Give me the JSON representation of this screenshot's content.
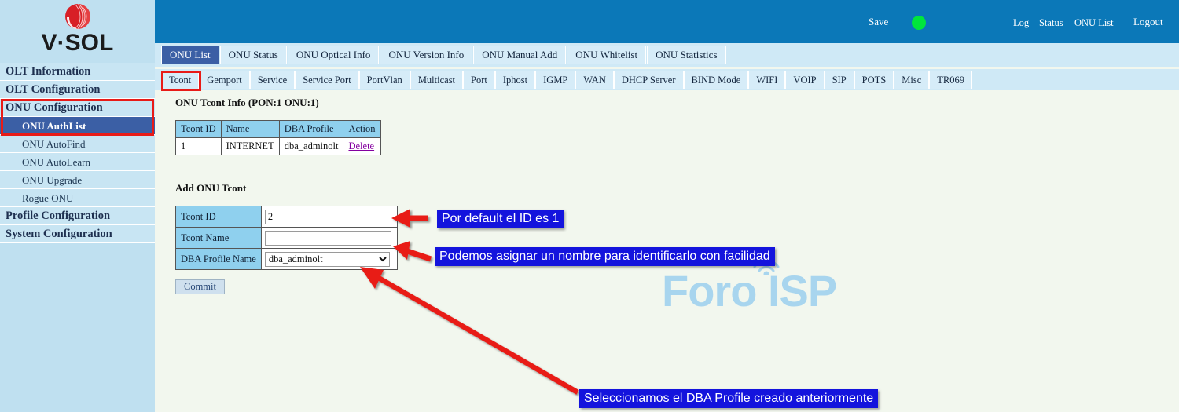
{
  "brand": {
    "logo_text": "V·SOL",
    "logo_icon": "vsol-ball-logo"
  },
  "sidebar": {
    "items": [
      {
        "label": "OLT Information",
        "level": "top",
        "selected": false
      },
      {
        "label": "OLT Configuration",
        "level": "top",
        "selected": false
      },
      {
        "label": "ONU Configuration",
        "level": "top",
        "selected": false
      },
      {
        "label": "ONU AuthList",
        "level": "sub",
        "selected": true
      },
      {
        "label": "ONU AutoFind",
        "level": "sub",
        "selected": false
      },
      {
        "label": "ONU AutoLearn",
        "level": "sub",
        "selected": false
      },
      {
        "label": "ONU Upgrade",
        "level": "sub",
        "selected": false
      },
      {
        "label": "Rogue ONU",
        "level": "sub",
        "selected": false
      },
      {
        "label": "Profile Configuration",
        "level": "top",
        "selected": false
      },
      {
        "label": "System Configuration",
        "level": "top",
        "selected": false
      }
    ]
  },
  "header": {
    "save_label": "Save",
    "status_indicator_color": "#00e63c",
    "links": [
      {
        "label": "Log"
      },
      {
        "label": "Status"
      },
      {
        "label": "ONU List"
      },
      {
        "label": "Logout"
      }
    ]
  },
  "tabs_primary": {
    "items": [
      {
        "label": "ONU List",
        "active": true
      },
      {
        "label": "ONU Status",
        "active": false
      },
      {
        "label": "ONU Optical Info",
        "active": false
      },
      {
        "label": "ONU Version Info",
        "active": false
      },
      {
        "label": "ONU Manual Add",
        "active": false
      },
      {
        "label": "ONU Whitelist",
        "active": false
      },
      {
        "label": "ONU Statistics",
        "active": false
      }
    ]
  },
  "tabs_secondary": {
    "items": [
      {
        "label": "Tcont",
        "highlighted": true
      },
      {
        "label": "Gemport",
        "highlighted": false
      },
      {
        "label": "Service",
        "highlighted": false
      },
      {
        "label": "Service Port",
        "highlighted": false
      },
      {
        "label": "PortVlan",
        "highlighted": false
      },
      {
        "label": "Multicast",
        "highlighted": false
      },
      {
        "label": "Port",
        "highlighted": false
      },
      {
        "label": "Iphost",
        "highlighted": false
      },
      {
        "label": "IGMP",
        "highlighted": false
      },
      {
        "label": "WAN",
        "highlighted": false
      },
      {
        "label": "DHCP Server",
        "highlighted": false
      },
      {
        "label": "BIND Mode",
        "highlighted": false
      },
      {
        "label": "WIFI",
        "highlighted": false
      },
      {
        "label": "VOIP",
        "highlighted": false
      },
      {
        "label": "SIP",
        "highlighted": false
      },
      {
        "label": "POTS",
        "highlighted": false
      },
      {
        "label": "Misc",
        "highlighted": false
      },
      {
        "label": "TR069",
        "highlighted": false
      }
    ]
  },
  "main": {
    "info_title": "ONU Tcont Info (PON:1 ONU:1)",
    "info_table": {
      "headers": [
        "Tcont ID",
        "Name",
        "DBA Profile",
        "Action"
      ],
      "rows": [
        [
          "1",
          "INTERNET",
          "dba_adminolt",
          "Delete"
        ]
      ]
    },
    "add_title": "Add ONU Tcont",
    "add_form": {
      "fields": [
        {
          "label": "Tcont ID",
          "value": "2",
          "type": "text"
        },
        {
          "label": "Tcont Name",
          "value": "",
          "type": "text"
        },
        {
          "label": "DBA Profile Name",
          "value": "dba_adminolt",
          "type": "select",
          "options": [
            "dba_adminolt"
          ]
        }
      ],
      "submit_label": "Commit"
    }
  },
  "watermark": {
    "text": "Foro ISP",
    "icon": "wifi-antenna-icon",
    "color": "#a8d5ee"
  },
  "annotations": [
    {
      "text": "Por default el ID es 1"
    },
    {
      "text": "Podemos asignar un nombre para identificarlo con facilidad"
    },
    {
      "text": "Seleccionamos el DBA Profile creado anteriormente"
    }
  ],
  "colors": {
    "header_blue": "#0b78b8",
    "sidebar_blue": "#c8e5f3",
    "selected_blue": "#3b5fa5",
    "highlight_red": "#e81b17",
    "annotation_blue": "#1414dd",
    "table_header_blue": "#8fd0ee",
    "page_background": "#f2f7ee"
  }
}
